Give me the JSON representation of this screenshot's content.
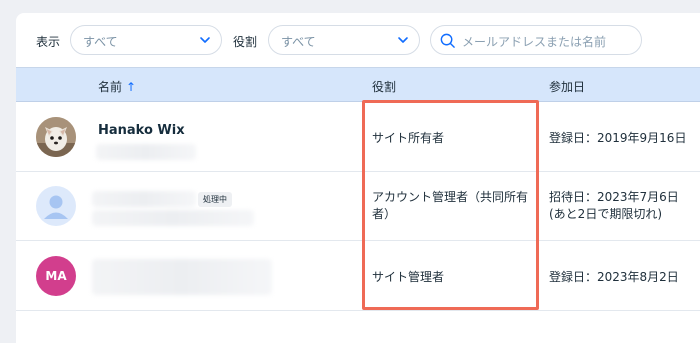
{
  "filters": {
    "display_label": "表示",
    "display_value": "すべて",
    "role_label": "役割",
    "role_value": "すべて",
    "search_placeholder": "メールアドレスまたは名前"
  },
  "table": {
    "headers": {
      "name": "名前",
      "sort_indicator": "↑",
      "role": "役割",
      "joined": "参加日"
    },
    "rows": [
      {
        "name": "Hanako Wix",
        "role": "サイト所有者",
        "joined_line1": "登録日：2019年9月16日",
        "joined_line2": "",
        "avatar": "photo-dog"
      },
      {
        "name": "",
        "badge": "処理中",
        "role_line1": "アカウント管理者（共同所有",
        "role_line2": "者）",
        "joined_line1": "招待日：2023年7月6日",
        "joined_line2": "(あと2日で期限切れ)",
        "avatar": "placeholder-person"
      },
      {
        "name": "",
        "avatar_initials": "MA",
        "role": "サイト管理者",
        "joined_line1": "登録日：2023年8月2日",
        "joined_line2": ""
      }
    ]
  },
  "colors": {
    "header_bg": "#d6e6fb",
    "sort_arrow": "#116dff",
    "highlight": "#ef6a56",
    "ma_avatar": "#d23e8d"
  }
}
